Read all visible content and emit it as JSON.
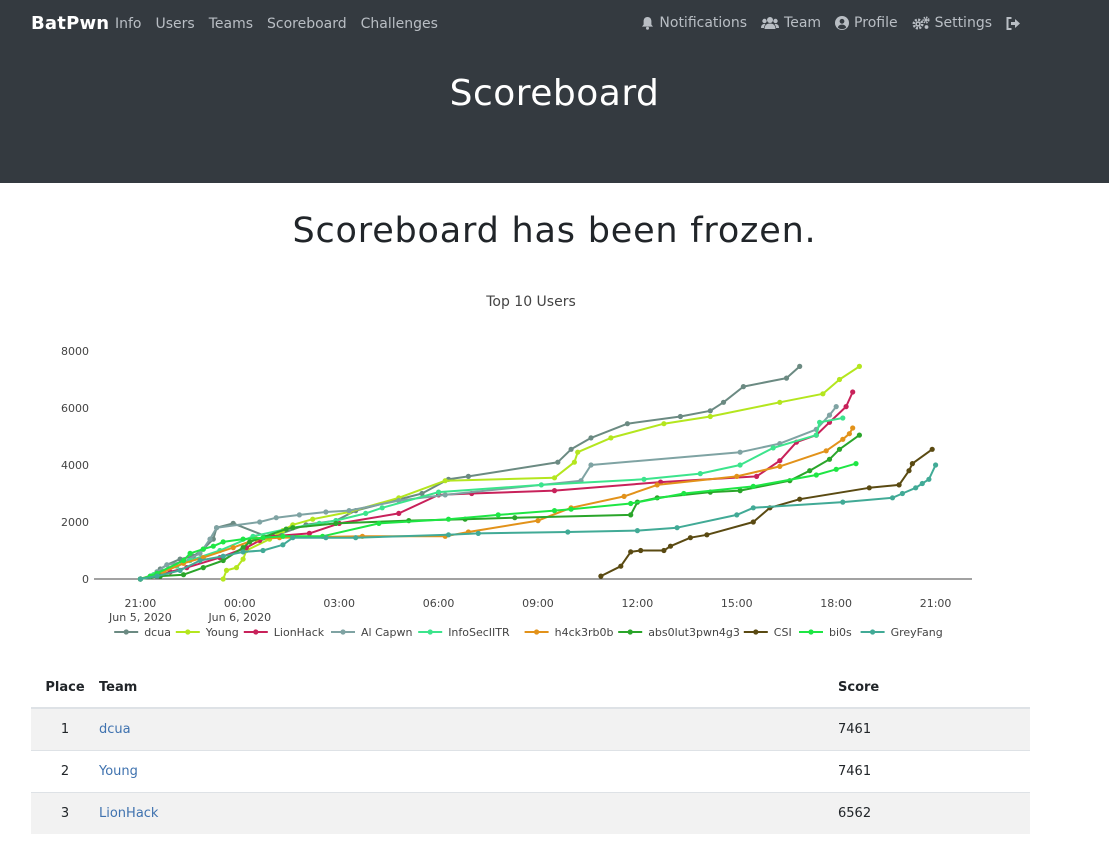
{
  "navbar": {
    "brand": "BatPwn",
    "left_items": [
      "Info",
      "Users",
      "Teams",
      "Scoreboard",
      "Challenges"
    ],
    "right_items": [
      {
        "label": "Notifications",
        "icon": "bell-icon"
      },
      {
        "label": "Team",
        "icon": "users-icon"
      },
      {
        "label": "Profile",
        "icon": "user-circle-icon"
      },
      {
        "label": "Settings",
        "icon": "cogs-icon"
      }
    ],
    "logout_icon": "sign-out-icon"
  },
  "header": {
    "title": "Scoreboard"
  },
  "notice": "Scoreboard has been frozen.",
  "chart_data": {
    "type": "line",
    "title": "Top 10 Users",
    "x_ticks": [
      {
        "label": "21:00",
        "sublabel": "Jun 5, 2020",
        "hours": 0
      },
      {
        "label": "00:00",
        "sublabel": "Jun 6, 2020",
        "hours": 3
      },
      {
        "label": "03:00",
        "sublabel": "",
        "hours": 6
      },
      {
        "label": "06:00",
        "sublabel": "",
        "hours": 9
      },
      {
        "label": "09:00",
        "sublabel": "",
        "hours": 12
      },
      {
        "label": "12:00",
        "sublabel": "",
        "hours": 15
      },
      {
        "label": "15:00",
        "sublabel": "",
        "hours": 18
      },
      {
        "label": "18:00",
        "sublabel": "",
        "hours": 21
      },
      {
        "label": "21:00",
        "sublabel": "",
        "hours": 24
      }
    ],
    "xlim": [
      -1.4,
      25.1
    ],
    "ylim": [
      0,
      8000
    ],
    "y_ticks": [
      0,
      2000,
      4000,
      6000,
      8000
    ],
    "legend_position": "bottom",
    "series": [
      {
        "name": "dcua",
        "color": "#6b8a82",
        "points": [
          [
            0,
            0
          ],
          [
            0.3,
            100
          ],
          [
            0.5,
            250
          ],
          [
            0.6,
            350
          ],
          [
            0.8,
            500
          ],
          [
            1.2,
            700
          ],
          [
            1.6,
            800
          ],
          [
            1.9,
            1050
          ],
          [
            2.2,
            1400
          ],
          [
            2.3,
            1800
          ],
          [
            2.8,
            1950
          ],
          [
            3.9,
            1450
          ],
          [
            5.0,
            1900
          ],
          [
            5.9,
            2050
          ],
          [
            6.5,
            2400
          ],
          [
            8.5,
            3000
          ],
          [
            9.3,
            3500
          ],
          [
            9.9,
            3600
          ],
          [
            12.6,
            4100
          ],
          [
            13.0,
            4550
          ],
          [
            13.6,
            4950
          ],
          [
            14.7,
            5450
          ],
          [
            16.3,
            5700
          ],
          [
            17.2,
            5900
          ],
          [
            17.6,
            6200
          ],
          [
            18.2,
            6750
          ],
          [
            19.5,
            7050
          ],
          [
            19.9,
            7461
          ]
        ]
      },
      {
        "name": "Young",
        "color": "#b4e61e",
        "points": [
          [
            2.5,
            0
          ],
          [
            2.6,
            300
          ],
          [
            2.9,
            400
          ],
          [
            3.1,
            700
          ],
          [
            3.2,
            1000
          ],
          [
            3.9,
            1400
          ],
          [
            4.3,
            1700
          ],
          [
            4.6,
            1900
          ],
          [
            5.2,
            2100
          ],
          [
            6.3,
            2350
          ],
          [
            7.8,
            2850
          ],
          [
            9.2,
            3450
          ],
          [
            12.5,
            3550
          ],
          [
            13.1,
            4100
          ],
          [
            13.2,
            4450
          ],
          [
            14.2,
            4950
          ],
          [
            15.8,
            5450
          ],
          [
            17.2,
            5700
          ],
          [
            19.3,
            6200
          ],
          [
            20.6,
            6500
          ],
          [
            21.1,
            7000
          ],
          [
            21.7,
            7461
          ]
        ]
      },
      {
        "name": "LionHack",
        "color": "#c8215a",
        "points": [
          [
            0,
            0
          ],
          [
            0.5,
            100
          ],
          [
            0.9,
            250
          ],
          [
            1.4,
            400
          ],
          [
            2.4,
            750
          ],
          [
            3.2,
            1100
          ],
          [
            3.6,
            1350
          ],
          [
            4.0,
            1500
          ],
          [
            5.1,
            1600
          ],
          [
            6.0,
            1950
          ],
          [
            7.8,
            2300
          ],
          [
            9.0,
            2950
          ],
          [
            10.0,
            3000
          ],
          [
            12.5,
            3100
          ],
          [
            15.7,
            3400
          ],
          [
            18.6,
            3600
          ],
          [
            19.3,
            4150
          ],
          [
            19.8,
            4800
          ],
          [
            20.4,
            5050
          ],
          [
            20.8,
            5500
          ],
          [
            21.3,
            6050
          ],
          [
            21.5,
            6562
          ]
        ]
      },
      {
        "name": "Al Capwn",
        "color": "#7fa3a3",
        "points": [
          [
            0,
            0
          ],
          [
            0.4,
            150
          ],
          [
            0.5,
            250
          ],
          [
            0.8,
            500
          ],
          [
            1.3,
            600
          ],
          [
            1.8,
            900
          ],
          [
            2.1,
            1400
          ],
          [
            2.3,
            1800
          ],
          [
            3.6,
            2000
          ],
          [
            4.1,
            2150
          ],
          [
            4.8,
            2250
          ],
          [
            5.6,
            2350
          ],
          [
            6.3,
            2400
          ],
          [
            7.8,
            2750
          ],
          [
            9.2,
            2950
          ],
          [
            13.3,
            3450
          ],
          [
            13.6,
            4000
          ],
          [
            18.1,
            4450
          ],
          [
            19.3,
            4750
          ],
          [
            20.4,
            5250
          ],
          [
            20.8,
            5750
          ],
          [
            21.0,
            6050
          ]
        ]
      },
      {
        "name": "InfoSecIITR",
        "color": "#3ce48c",
        "points": [
          [
            0,
            0
          ],
          [
            0.4,
            150
          ],
          [
            1.1,
            450
          ],
          [
            1.5,
            650
          ],
          [
            2.4,
            1000
          ],
          [
            3.4,
            1500
          ],
          [
            4.6,
            1800
          ],
          [
            5.4,
            1950
          ],
          [
            5.9,
            2050
          ],
          [
            6.8,
            2300
          ],
          [
            7.3,
            2500
          ],
          [
            9.0,
            3050
          ],
          [
            12.1,
            3300
          ],
          [
            15.2,
            3500
          ],
          [
            16.9,
            3700
          ],
          [
            18.1,
            4000
          ],
          [
            19.1,
            4600
          ],
          [
            20.4,
            5050
          ],
          [
            20.5,
            5500
          ],
          [
            21.2,
            5650
          ]
        ]
      },
      {
        "name": "h4ck3rb0b",
        "color": "#e2921a",
        "points": [
          [
            0,
            0
          ],
          [
            0.7,
            250
          ],
          [
            1.3,
            550
          ],
          [
            1.9,
            750
          ],
          [
            2.8,
            1100
          ],
          [
            3.5,
            1400
          ],
          [
            4.2,
            1450
          ],
          [
            6.7,
            1500
          ],
          [
            9.2,
            1500
          ],
          [
            9.9,
            1650
          ],
          [
            12.0,
            2050
          ],
          [
            13.0,
            2500
          ],
          [
            14.6,
            2900
          ],
          [
            15.6,
            3300
          ],
          [
            18.0,
            3600
          ],
          [
            19.3,
            3950
          ],
          [
            20.7,
            4500
          ],
          [
            21.2,
            4900
          ],
          [
            21.4,
            5100
          ],
          [
            21.5,
            5300
          ]
        ]
      },
      {
        "name": "abs0lut3pwn4g3",
        "color": "#2aa52a",
        "points": [
          [
            0,
            0
          ],
          [
            0.6,
            100
          ],
          [
            1.3,
            150
          ],
          [
            1.9,
            400
          ],
          [
            2.5,
            650
          ],
          [
            3.1,
            1100
          ],
          [
            3.3,
            1300
          ],
          [
            4.4,
            1750
          ],
          [
            4.6,
            1800
          ],
          [
            5.9,
            1950
          ],
          [
            8.1,
            2050
          ],
          [
            9.8,
            2100
          ],
          [
            11.3,
            2150
          ],
          [
            14.8,
            2250
          ],
          [
            15.0,
            2700
          ],
          [
            15.6,
            2850
          ],
          [
            17.2,
            3050
          ],
          [
            18.1,
            3100
          ],
          [
            19.6,
            3450
          ],
          [
            20.2,
            3800
          ],
          [
            20.8,
            4200
          ],
          [
            21.1,
            4550
          ],
          [
            21.7,
            5050
          ]
        ]
      },
      {
        "name": "CSI",
        "color": "#5a4a12",
        "points": [
          [
            13.9,
            100
          ],
          [
            14.5,
            450
          ],
          [
            14.8,
            950
          ],
          [
            15.1,
            1000
          ],
          [
            15.8,
            1000
          ],
          [
            16.0,
            1150
          ],
          [
            16.6,
            1450
          ],
          [
            17.1,
            1550
          ],
          [
            18.5,
            2000
          ],
          [
            19.0,
            2500
          ],
          [
            19.9,
            2800
          ],
          [
            22.0,
            3200
          ],
          [
            22.9,
            3300
          ],
          [
            23.2,
            3800
          ],
          [
            23.3,
            4050
          ],
          [
            23.9,
            4550
          ]
        ]
      },
      {
        "name": "bi0s",
        "color": "#1ee644",
        "points": [
          [
            0,
            0
          ],
          [
            0.3,
            100
          ],
          [
            0.5,
            200
          ],
          [
            1.3,
            650
          ],
          [
            1.5,
            900
          ],
          [
            1.9,
            1050
          ],
          [
            2.2,
            1150
          ],
          [
            2.5,
            1300
          ],
          [
            3.1,
            1400
          ],
          [
            3.7,
            1450
          ],
          [
            4.3,
            1500
          ],
          [
            5.5,
            1500
          ],
          [
            7.2,
            1950
          ],
          [
            9.3,
            2100
          ],
          [
            10.8,
            2250
          ],
          [
            12.5,
            2400
          ],
          [
            13.0,
            2450
          ],
          [
            14.8,
            2650
          ],
          [
            16.4,
            3000
          ],
          [
            18.5,
            3250
          ],
          [
            20.4,
            3650
          ],
          [
            21.0,
            3850
          ],
          [
            21.6,
            4050
          ]
        ]
      },
      {
        "name": "GreyFang",
        "color": "#41aa96",
        "points": [
          [
            0,
            0
          ],
          [
            0.5,
            100
          ],
          [
            1.2,
            300
          ],
          [
            1.8,
            650
          ],
          [
            2.5,
            800
          ],
          [
            3.1,
            950
          ],
          [
            3.7,
            1000
          ],
          [
            4.3,
            1200
          ],
          [
            4.6,
            1450
          ],
          [
            5.6,
            1450
          ],
          [
            6.5,
            1450
          ],
          [
            9.3,
            1550
          ],
          [
            10.2,
            1600
          ],
          [
            12.9,
            1650
          ],
          [
            15.0,
            1700
          ],
          [
            16.2,
            1800
          ],
          [
            18.0,
            2250
          ],
          [
            18.5,
            2500
          ],
          [
            21.2,
            2700
          ],
          [
            22.7,
            2850
          ],
          [
            23.0,
            3000
          ],
          [
            23.4,
            3200
          ],
          [
            23.6,
            3350
          ],
          [
            23.8,
            3500
          ],
          [
            24.0,
            4000
          ]
        ]
      }
    ]
  },
  "table": {
    "headers": {
      "place": "Place",
      "team": "Team",
      "score": "Score"
    },
    "rows": [
      {
        "place": "1",
        "team": "dcua",
        "score": "7461"
      },
      {
        "place": "2",
        "team": "Young",
        "score": "7461"
      },
      {
        "place": "3",
        "team": "LionHack",
        "score": "6562"
      }
    ]
  }
}
